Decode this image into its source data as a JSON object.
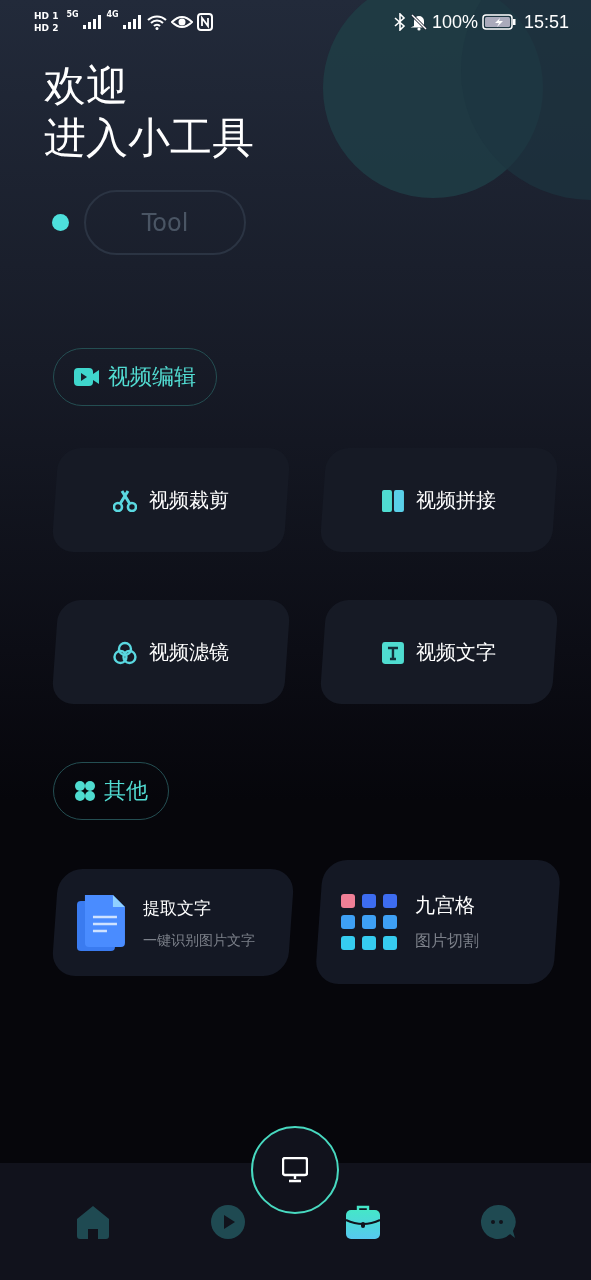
{
  "status_bar": {
    "sim_labels": [
      "HD 1",
      "HD 2"
    ],
    "networks": [
      "5G",
      "4G"
    ],
    "battery": "100%",
    "time": "15:51"
  },
  "welcome": {
    "lines": [
      "欢迎",
      "进入小工具"
    ]
  },
  "tag": {
    "label": "Tool"
  },
  "sections": [
    {
      "title": "视频编辑",
      "kind": "grid",
      "items": [
        {
          "label": "视频裁剪",
          "kind": "scissors"
        },
        {
          "label": "视频拼接",
          "kind": "split"
        },
        {
          "label": "视频滤镜",
          "kind": "circles"
        },
        {
          "label": "视频文字",
          "kind": "text"
        }
      ]
    },
    {
      "title": "其他",
      "kind": "cards",
      "items": [
        {
          "label": "提取文字",
          "subtitle": "一键识别图片文字",
          "kind": "document"
        },
        {
          "label": "九宫格",
          "subtitle": "图片切割",
          "kind": "grid"
        }
      ]
    }
  ],
  "tab_bar": [
    {
      "kind": "home",
      "selected": false
    },
    {
      "kind": "play",
      "selected": false
    },
    {
      "kind": "center",
      "selected": false
    },
    {
      "kind": "tools",
      "selected": true
    },
    {
      "kind": "chat",
      "selected": false
    }
  ]
}
